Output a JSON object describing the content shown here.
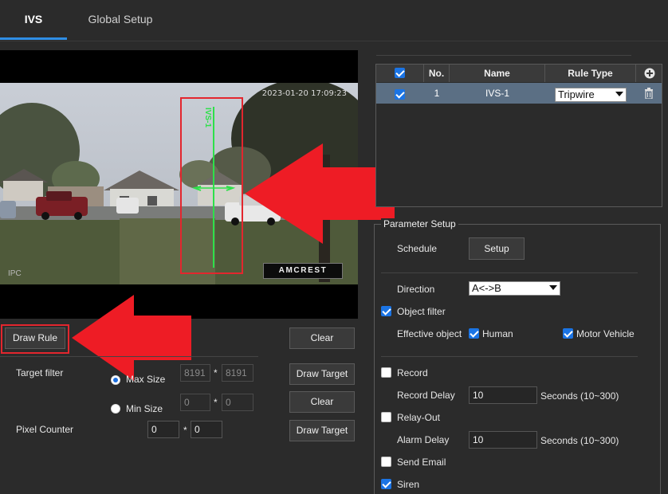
{
  "tabs": [
    {
      "label": "IVS",
      "active": true
    },
    {
      "label": "Global Setup",
      "active": false
    }
  ],
  "video": {
    "timestamp": "2023-01-20 17:09:23",
    "channel_label": "IPC",
    "brand": "AMCREST",
    "rule_overlay_text": "IVS-1"
  },
  "left_panel": {
    "draw_rule_label": "Draw Rule",
    "clear_label": "Clear",
    "draw_target_label": "Draw Target",
    "target_filter_label": "Target filter",
    "max_size_label": "Max Size",
    "max_w": "8191",
    "max_h": "8191",
    "min_size_label": "Min Size",
    "min_w": "0",
    "min_h": "0",
    "times": "*",
    "pixel_counter_label": "Pixel Counter",
    "pc_w": "0",
    "pc_h": "0"
  },
  "rule_table": {
    "headers": {
      "no": "No.",
      "name": "Name",
      "rule_type": "Rule Type"
    },
    "rows": [
      {
        "checked": true,
        "no": "1",
        "name": "IVS-1",
        "rule_type": "Tripwire"
      }
    ]
  },
  "parameter_setup": {
    "title": "Parameter Setup",
    "schedule_label": "Schedule",
    "setup_button": "Setup",
    "direction_label": "Direction",
    "direction_value": "A<->B",
    "object_filter_label": "Object filter",
    "effective_object_label": "Effective object",
    "human_label": "Human",
    "motor_vehicle_label": "Motor Vehicle",
    "record_label": "Record",
    "record_delay_label": "Record Delay",
    "record_delay_value": "10",
    "seconds_range": "Seconds (10~300)",
    "relay_out_label": "Relay-Out",
    "alarm_delay_label": "Alarm Delay",
    "alarm_delay_value": "10",
    "send_email_label": "Send Email",
    "siren_label": "Siren"
  },
  "colors": {
    "accent": "#2f8ee5",
    "highlight_red": "#e3262e",
    "rule_line": "#2ee04a",
    "selected_row": "#5b6f84"
  },
  "icons": [
    "add-icon",
    "trash-icon",
    "left-arrow-icon"
  ]
}
